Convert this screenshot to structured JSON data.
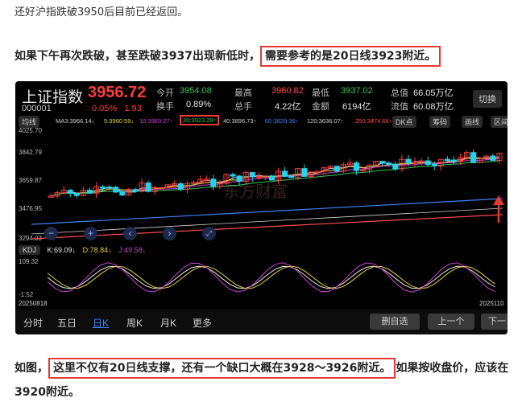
{
  "article": {
    "para_top": "还好沪指跌破3950后目前已经返回。",
    "para_mid_plain": "如果下午再次跌破，甚至跌破3937出现新低时，",
    "para_mid_boxed": "需要参考的是20日线3923附近。",
    "para_bot_lead": "如图，",
    "para_bot_boxed": "这里不仅有20日线支撑，还有一个缺口大概在3928～3926附近。",
    "para_bot_tail": "如果按收盘价，应该在3920附近。"
  },
  "quote": {
    "name": "上证指数",
    "price": "3956.72",
    "code": "000001",
    "change_pct": "0.05%",
    "change_abs": "1.93",
    "open_label": "今开",
    "open_value": "3954.08",
    "turnover_label": "换手",
    "turnover_value": "0.89%",
    "high_label": "最高",
    "high_value": "3960.82",
    "volume_label": "总手",
    "volume_value": "4.22亿",
    "low_label": "最低",
    "low_value": "3937.02",
    "amount_label": "金额",
    "amount_value": "6194亿",
    "total_cap_label": "总值",
    "total_cap_value": "66.05万亿",
    "float_cap_label": "流值",
    "float_cap_value": "60.08万亿",
    "switch_label": "切换"
  },
  "chart_toolbar": {
    "mode_label": "均线",
    "ma_items": [
      {
        "text": "MA3:3966.14↓",
        "color": "#cfcfcf"
      },
      {
        "text": "5:3960.59↓",
        "color": "#e6d03a"
      },
      {
        "text": "10:3969.27↑",
        "color": "#d040d0"
      },
      {
        "text": "20:3923.29↑",
        "color": "#34c759"
      },
      {
        "text": "40:3896.73↑",
        "color": "#cfcfcf"
      },
      {
        "text": "60:3829.36↑",
        "color": "#3b82f6"
      },
      {
        "text": "120:3636.07↑",
        "color": "#cfcfcf"
      },
      {
        "text": "250:3474.66↑",
        "color": "#ff4d4d"
      }
    ],
    "dk_label": "DK点",
    "chip_label": "筹码",
    "draw_label": "画线",
    "range_label": "区间统计"
  },
  "price_axis": [
    "4025.70",
    "3842.79",
    "3659.87",
    "3476.95",
    "3294.03"
  ],
  "watermark": "东方财富",
  "kdj": {
    "label": "KDJ",
    "k": "K:69.09↓",
    "d": "D:78.84↓",
    "j": "J:49.58↓",
    "axis_top": "109.32",
    "axis_bottom": "-1.52",
    "date_start": "20250818",
    "date_end": "2025110"
  },
  "colors": {
    "up": "#ff3b3b",
    "down": "#22d3ee",
    "ma20": "#34c759",
    "highlight_box": "#e53935",
    "k_line": "#e6e6e6",
    "d_line": "#e6d03a",
    "j_line": "#d040d0"
  },
  "control_icons": [
    "minus-icon",
    "plus-icon",
    "arrow-left-icon",
    "arrow-right-icon",
    "expand-icon"
  ],
  "tabs": [
    "分时",
    "五日",
    "日K",
    "周K",
    "月K",
    "更多"
  ],
  "active_tab": "日K",
  "bottom_buttons": [
    "删自选",
    "上一个",
    "下一"
  ]
}
